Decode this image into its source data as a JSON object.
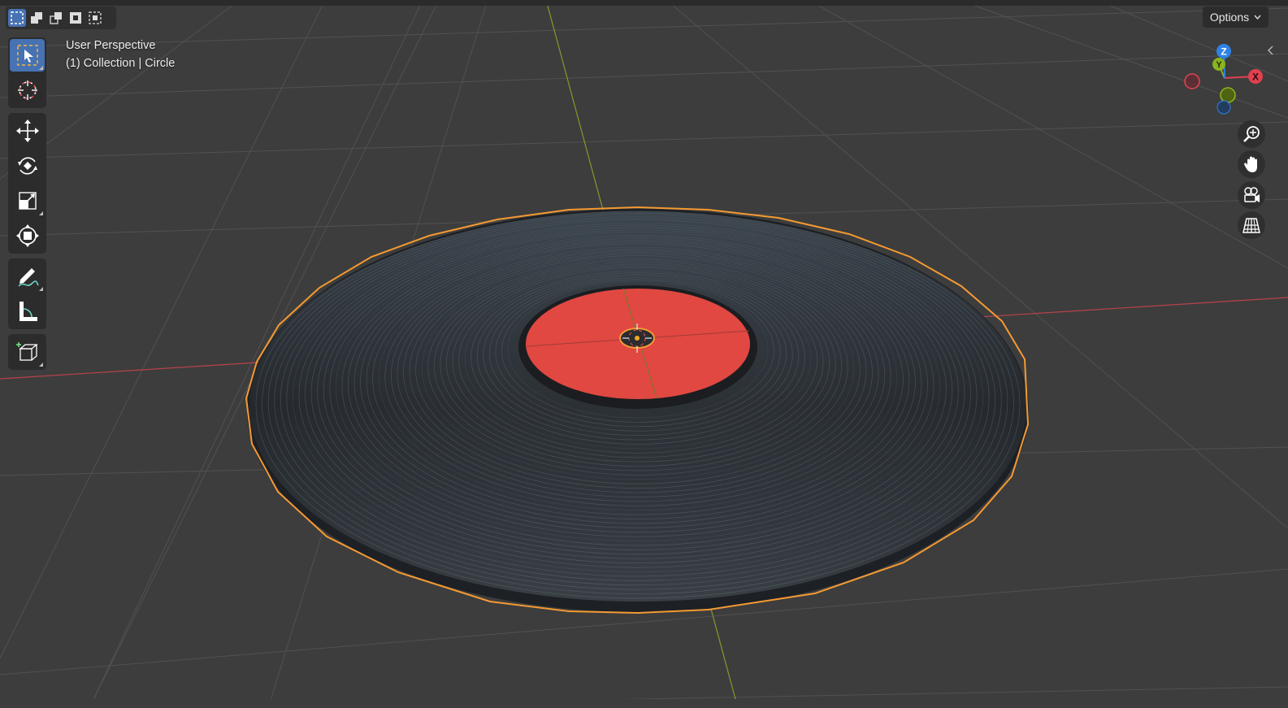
{
  "viewport": {
    "view_name": "User Perspective",
    "collection_line": "(1) Collection | Circle"
  },
  "header": {
    "options_label": "Options",
    "selection_modes": [
      "set-new-selection",
      "extend-selection",
      "subtract-selection",
      "invert-selection",
      "intersect-selection"
    ]
  },
  "toolbar": {
    "tools": [
      {
        "name": "select-box",
        "icon": "cursor-select-icon",
        "active": true
      },
      {
        "name": "cursor",
        "icon": "3d-cursor-icon",
        "active": false
      },
      {
        "name": "move",
        "icon": "move-arrows-icon",
        "active": false
      },
      {
        "name": "rotate",
        "icon": "rotate-icon",
        "active": false
      },
      {
        "name": "scale",
        "icon": "scale-icon",
        "active": false
      },
      {
        "name": "transform",
        "icon": "transform-icon",
        "active": false
      },
      {
        "name": "annotate",
        "icon": "annotate-pencil-icon",
        "active": false
      },
      {
        "name": "measure",
        "icon": "measure-ruler-icon",
        "active": false
      },
      {
        "name": "add-cube",
        "icon": "add-cube-icon",
        "active": false
      }
    ]
  },
  "gizmo": {
    "z_label": "Z",
    "y_label": "Y",
    "x_label": "X",
    "colors": {
      "x": "#e0414f",
      "y": "#8bb31d",
      "z": "#2f83e6"
    }
  },
  "navigation": [
    "zoom-icon",
    "pan-hand-icon",
    "camera-icon",
    "grid-perspective-icon"
  ],
  "scene": {
    "record_color": "#262a2e",
    "label_color": "#e04841",
    "outline_color": "#f59a32",
    "x_axis_color": "#b8434b",
    "y_axis_color": "#7f9c2c",
    "background": "#3d3d3d"
  }
}
